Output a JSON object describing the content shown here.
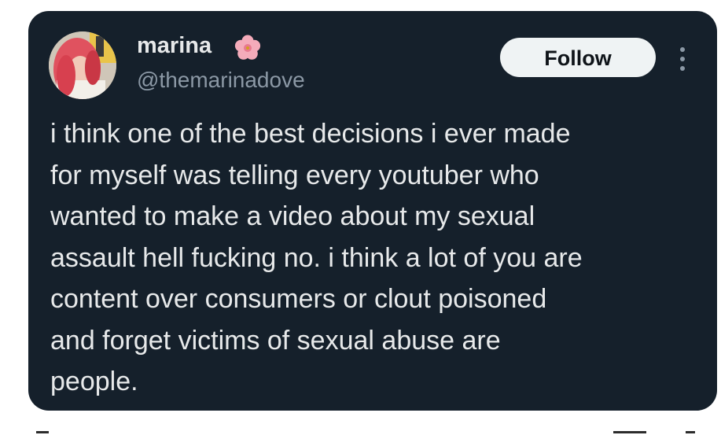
{
  "author": {
    "display_name": "marina",
    "badge_icon": "cherry-blossom-icon",
    "handle": "@themarinadove"
  },
  "actions": {
    "follow_label": "Follow",
    "more_icon": "more-options-icon"
  },
  "tweet": {
    "lines": [
      "i think one of the best decisions i ever made",
      "for myself was telling every youtuber who",
      "wanted to make a video about my sexual",
      "assault hell fucking no. i think a lot of you are",
      "content over consumers or clout poisoned",
      "and forget victims of sexual abuse are",
      "people."
    ]
  },
  "colors": {
    "card_background": "#15202b",
    "primary_text": "#e7e9ea",
    "secondary_text": "#8b98a5",
    "button_background": "#eff3f4",
    "flower_pink": "#f4abba"
  }
}
